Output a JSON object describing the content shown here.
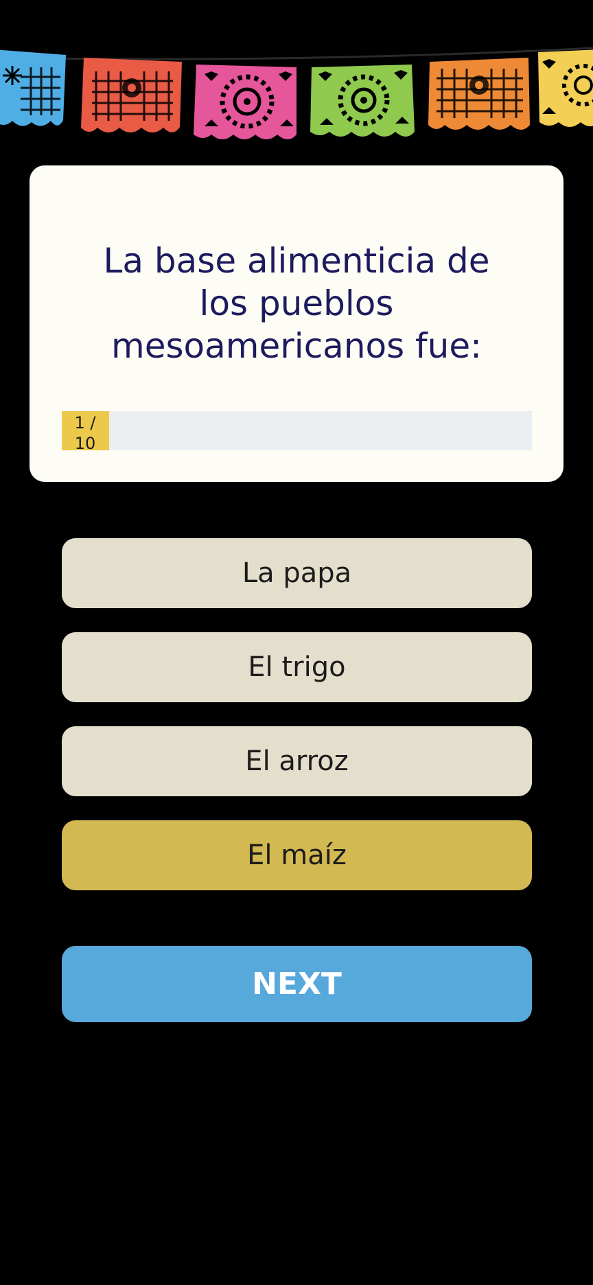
{
  "banner": {
    "icon": "papel-picado-banner",
    "flag_colors": [
      "#4faee6",
      "#e95b45",
      "#e6569b",
      "#8fc94d",
      "#ee8a35",
      "#f3cf55"
    ]
  },
  "question": {
    "text": "La base alimenticia de los pueblos mesoamericanos fue:"
  },
  "progress": {
    "label": "1 / 10",
    "current": 1,
    "total": 10,
    "fill_color": "#ecc94b",
    "track_color": "#eceff1"
  },
  "options": [
    {
      "label": "La papa",
      "selected": false
    },
    {
      "label": "El trigo",
      "selected": false
    },
    {
      "label": "El arroz",
      "selected": false
    },
    {
      "label": "El maíz",
      "selected": true
    }
  ],
  "next_button": {
    "label": "NEXT",
    "color": "#57a9dc"
  },
  "colors": {
    "background": "#000000",
    "card": "#fdfdf5",
    "question_text": "#1d1b5e",
    "option_default": "#e4dfcc",
    "option_selected": "#d3b952"
  }
}
